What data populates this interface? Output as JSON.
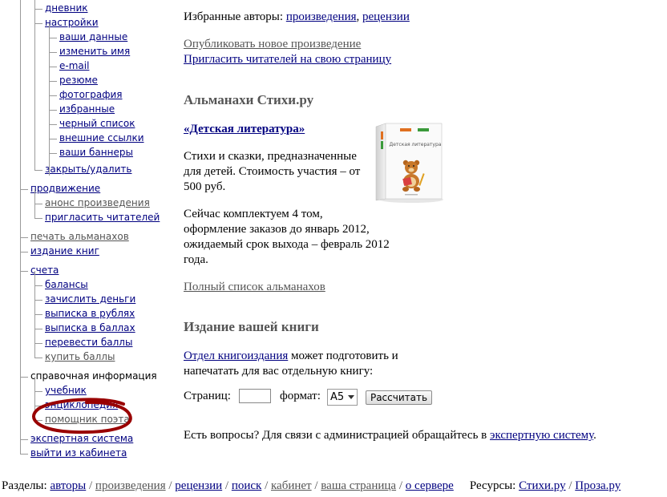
{
  "sidebar": {
    "items": [
      {
        "label": "дневник",
        "level": 1,
        "style": "link"
      },
      {
        "label": "настройки",
        "level": 1,
        "style": "link"
      },
      {
        "label": "ваши данные",
        "level": 2,
        "style": "link"
      },
      {
        "label": "изменить имя",
        "level": 2,
        "style": "link"
      },
      {
        "label": "e-mail",
        "level": 2,
        "style": "link"
      },
      {
        "label": "резюме",
        "level": 2,
        "style": "link"
      },
      {
        "label": "фотография",
        "level": 2,
        "style": "link"
      },
      {
        "label": "избранные",
        "level": 2,
        "style": "link"
      },
      {
        "label": "черный список",
        "level": 2,
        "style": "link"
      },
      {
        "label": "внешние ссылки",
        "level": 2,
        "style": "link"
      },
      {
        "label": "ваши баннеры",
        "level": 2,
        "style": "link"
      },
      {
        "label": "закрыть/удалить",
        "level": 1,
        "style": "link"
      },
      {
        "label": "продвижение",
        "level": 0,
        "style": "link"
      },
      {
        "label": "анонс произведения",
        "level": 1,
        "style": "grey"
      },
      {
        "label": "пригласить читателей",
        "level": 1,
        "style": "link"
      },
      {
        "label": "печать альманахов",
        "level": 0,
        "style": "grey"
      },
      {
        "label": "издание книг",
        "level": 0,
        "style": "link"
      },
      {
        "label": "счета",
        "level": 0,
        "style": "link"
      },
      {
        "label": "балансы",
        "level": 1,
        "style": "link"
      },
      {
        "label": "зачислить деньги",
        "level": 1,
        "style": "link"
      },
      {
        "label": "выписка в рублях",
        "level": 1,
        "style": "link"
      },
      {
        "label": "выписка в баллах",
        "level": 1,
        "style": "link"
      },
      {
        "label": "перевести баллы",
        "level": 1,
        "style": "link"
      },
      {
        "label": "купить баллы",
        "level": 1,
        "style": "grey"
      },
      {
        "label": "справочная информация",
        "level": 0,
        "style": "text"
      },
      {
        "label": "учебник",
        "level": 1,
        "style": "link"
      },
      {
        "label": "энциклопедия",
        "level": 1,
        "style": "link"
      },
      {
        "label": "помощник поэта",
        "level": 1,
        "style": "grey"
      },
      {
        "label": "экспертная система",
        "level": 0,
        "style": "link"
      },
      {
        "label": "выйти из кабинета",
        "level": 0,
        "style": "link"
      }
    ]
  },
  "main": {
    "favorites_prefix": "Избранные авторы: ",
    "favorites_works": "произведения",
    "favorites_comma": ", ",
    "favorites_reviews": "рецензии",
    "publish_link": "Опубликовать новое произведение",
    "invite_link": "Пригласить читателей на свою страницу",
    "almanacs_heading": "Альманахи Стихи.ру",
    "almanac_title_link": "«Детская литература»",
    "almanac_desc_line1": "Стихи и сказки, предназначенные",
    "almanac_desc_line2": "для детей. Стоимость участия – от",
    "almanac_desc_line3": "500 руб.",
    "almanac_status_line1": "Сейчас комплектуем 4 том,",
    "almanac_status_line2": "оформление заказов до январь 2012,",
    "almanac_status_line3": "ожидаемый срок выхода – февраль 2012",
    "almanac_status_line4": "года.",
    "almanac_list_link": "Полный список альманахов",
    "book_cover_title": "Детская литература",
    "book_heading": "Издание вашей книги",
    "book_dept_link": "Отдел книгоиздания",
    "book_desc_line1_rest": " может подготовить и",
    "book_desc_line2": "напечатать для вас отдельную книгу:",
    "pages_label": "Страниц:",
    "pages_value": "",
    "format_label": "формат:",
    "format_value": "A5",
    "calc_button": "Рассчитать",
    "questions_text": "Есть вопросы? Для связи с администрацией обращайтесь в ",
    "questions_link": "экспертную систему",
    "questions_dot": "."
  },
  "footer": {
    "sections_label": "Разделы: ",
    "sections": [
      "авторы",
      "произведения",
      "рецензии",
      "поиск",
      "кабинет",
      "ваша страница",
      "о сервере"
    ],
    "sections_style": [
      "link",
      "grey",
      "link",
      "link",
      "grey",
      "grey",
      "link"
    ],
    "separator": " / ",
    "resources_label": "Ресурсы: ",
    "resources": [
      "Стихи.ру",
      "Проза.ру"
    ]
  },
  "colors": {
    "link": "#000080",
    "grey_link": "#555555",
    "tree_line": "#9a9a9a",
    "annotation_red": "#990000"
  },
  "annotation": {
    "type": "hand-drawn-ellipse",
    "target": "помощник поэта"
  }
}
